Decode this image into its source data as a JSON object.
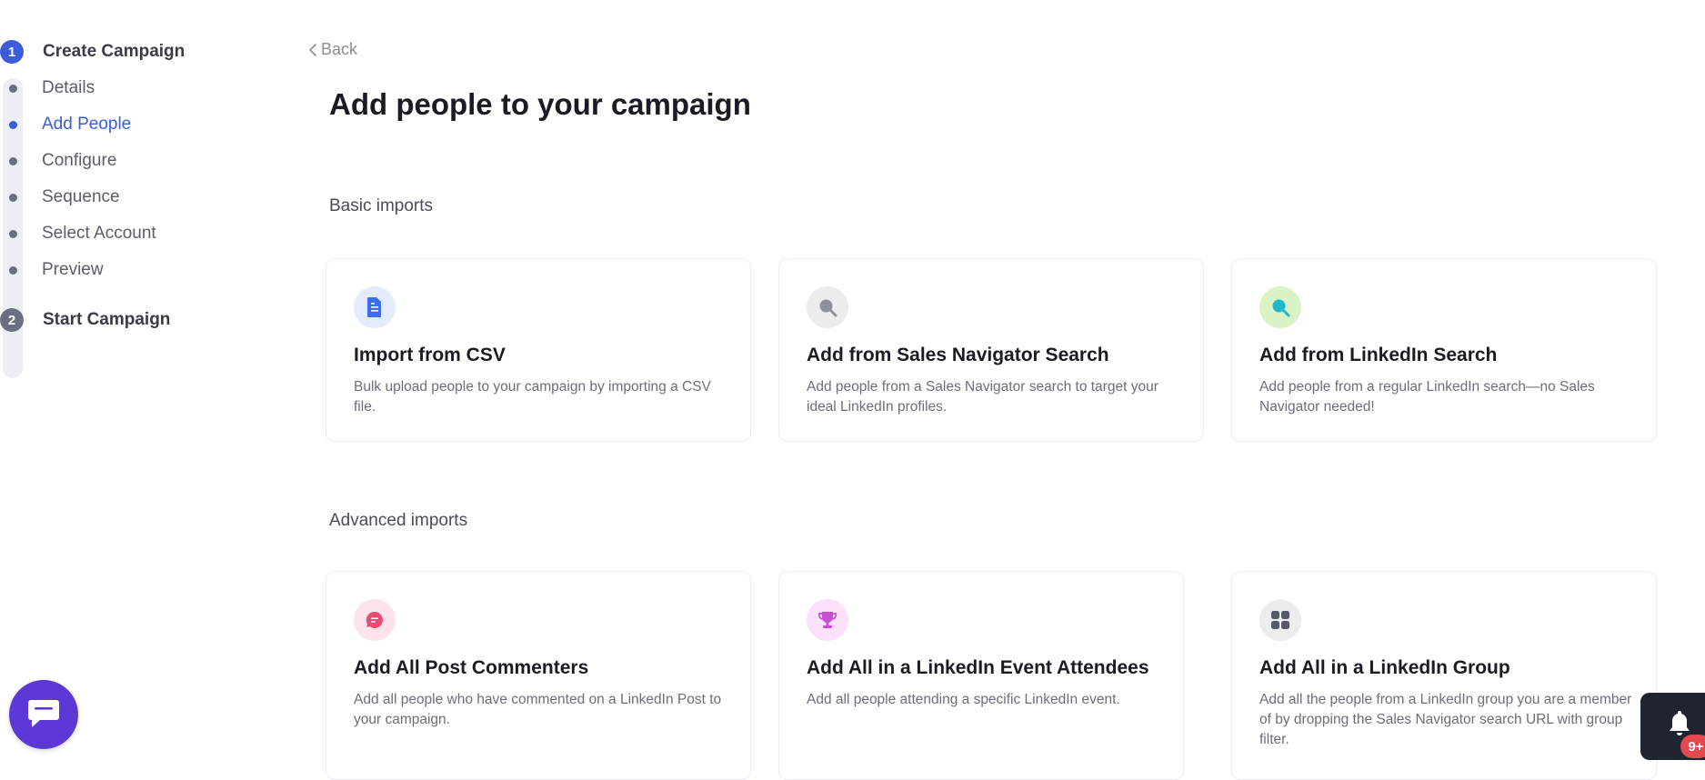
{
  "stepper": {
    "step1": {
      "number": "1",
      "title": "Create Campaign"
    },
    "substeps": [
      {
        "label": "Details",
        "active": false
      },
      {
        "label": "Add People",
        "active": true
      },
      {
        "label": "Configure",
        "active": false
      },
      {
        "label": "Sequence",
        "active": false
      },
      {
        "label": "Select Account",
        "active": false
      },
      {
        "label": "Preview",
        "active": false
      }
    ],
    "step2": {
      "number": "2",
      "title": "Start Campaign"
    }
  },
  "back_label": "Back",
  "page_title": "Add people to your campaign",
  "basic": {
    "label": "Basic imports",
    "cards": [
      {
        "title": "Import from CSV",
        "desc": "Bulk upload people to your campaign by importing a CSV file.",
        "icon": "csv-file-icon"
      },
      {
        "title": "Add from Sales Navigator Search",
        "desc": "Add people from a Sales Navigator search to target your ideal LinkedIn profiles.",
        "icon": "sales-navigator-search-icon"
      },
      {
        "title": "Add from LinkedIn Search",
        "desc": "Add people from a regular LinkedIn search—no Sales Navigator needed!",
        "icon": "linkedin-search-icon"
      }
    ]
  },
  "advanced": {
    "label": "Advanced imports",
    "cards": [
      {
        "title": "Add All Post Commenters",
        "desc": "Add all people who have commented on a LinkedIn Post to your campaign.",
        "icon": "comment-icon"
      },
      {
        "title": "Add All in a LinkedIn Event Attendees",
        "desc": "Add all people attending a specific LinkedIn event.",
        "icon": "trophy-icon"
      },
      {
        "title": "Add All in a LinkedIn Group",
        "desc": "Add all the people from a LinkedIn group you are a member of by dropping the Sales Navigator search URL with group filter.",
        "icon": "group-grid-icon"
      }
    ]
  },
  "notifications": {
    "badge": "9+"
  },
  "colors": {
    "accent": "#3b5bdb",
    "chat": "#5c39d6",
    "badge": "#e5484d"
  }
}
